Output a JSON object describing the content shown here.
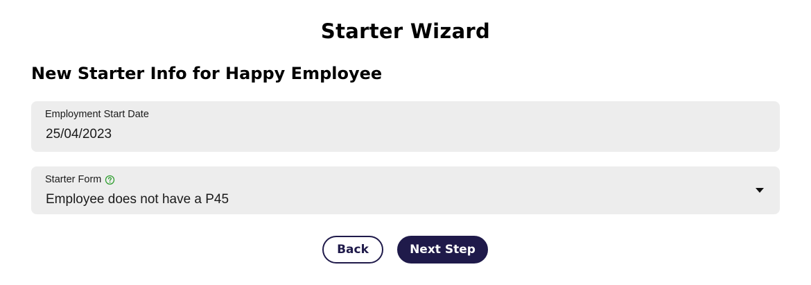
{
  "wizard": {
    "title": "Starter Wizard",
    "subtitle": "New Starter Info for Happy Employee"
  },
  "fields": {
    "start_date": {
      "label": "Employment Start Date",
      "value": "25/04/2023"
    },
    "starter_form": {
      "label": "Starter Form",
      "value": "Employee does not have a P45",
      "help_icon": "question-circle-icon",
      "dropdown_icon": "caret-down-icon"
    }
  },
  "buttons": {
    "back_label": "Back",
    "next_label": "Next Step"
  },
  "colors": {
    "primary": "#1f1a4a",
    "field_background": "#ededed",
    "help_icon": "#2e9e2e"
  }
}
